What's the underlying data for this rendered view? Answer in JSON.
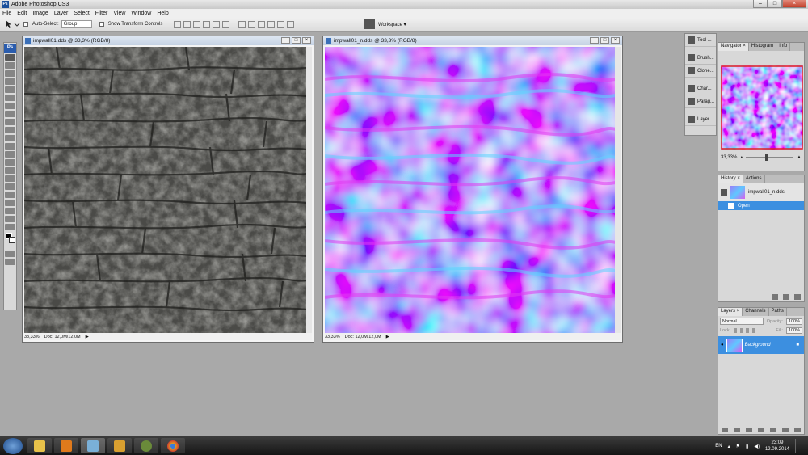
{
  "titlebar": {
    "title": "Adobe Photoshop CS3",
    "app_icon": "Ps"
  },
  "menu": [
    "File",
    "Edit",
    "Image",
    "Layer",
    "Select",
    "Filter",
    "View",
    "Window",
    "Help"
  ],
  "options": {
    "auto_select_label": "Auto-Select:",
    "auto_select_value": "Group",
    "show_transform_label": "Show Transform Controls",
    "workspace_label": "Workspace ▾"
  },
  "toolbox": {
    "logo": "Ps"
  },
  "doc1": {
    "title": "impwall01.dds @ 33,3% (RGB/8)",
    "zoom": "33,33%",
    "doc": "Doc: 12,0M/12,0M"
  },
  "doc2": {
    "title": "impwall01_n.dds @ 33,3% (RGB/8)",
    "zoom": "33,33%",
    "doc": "Doc: 12,0M/12,0M"
  },
  "panel_strip": [
    "Tool ...",
    "Brush...",
    "Clone...",
    "Char...",
    "Parag...",
    "Layer..."
  ],
  "navigator": {
    "tabs": [
      "Navigator ×",
      "Histogram",
      "Info"
    ],
    "zoom": "33,33%"
  },
  "history": {
    "tabs": [
      "History ×",
      "Actions"
    ],
    "snapshot": "impwall01_n.dds",
    "step": "Open"
  },
  "layers": {
    "tabs": [
      "Layers ×",
      "Channels",
      "Paths"
    ],
    "blend": "Normal",
    "opacity_label": "Opacity:",
    "opacity": "100%",
    "lock_label": "Lock:",
    "fill_label": "Fill:",
    "fill": "100%",
    "layer_name": "Background"
  },
  "taskbar": {
    "lang": "EN",
    "time": "23:09",
    "date": "12.09.2014"
  },
  "colors": {
    "selection_blue": "#3c8fe0",
    "doc_bg": "#a9a9a9"
  }
}
